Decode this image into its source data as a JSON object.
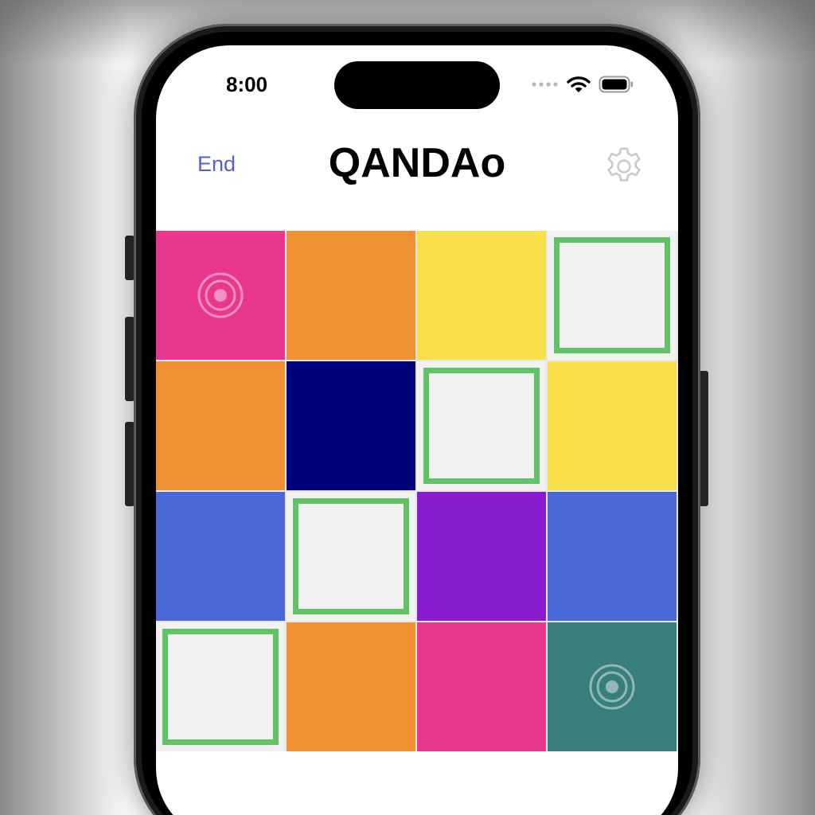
{
  "status_bar": {
    "time": "8:00",
    "signal_icon": "signal-dots-icon",
    "wifi_icon": "wifi-icon",
    "battery_icon": "battery-icon"
  },
  "nav": {
    "end_label": "End",
    "title": "QANDAo",
    "settings_icon": "gear-icon",
    "end_color": "#5a5bd6"
  },
  "board": {
    "empty_border_color": "#62c266",
    "tiles": [
      {
        "color": "#e9378e",
        "icon": "target-icon"
      },
      {
        "color": "#f09234",
        "icon": null
      },
      {
        "color": "#f9df4b",
        "icon": null
      },
      {
        "color": "empty",
        "icon": null
      },
      {
        "color": "#f09234",
        "icon": null
      },
      {
        "color": "#00007b",
        "icon": null
      },
      {
        "color": "empty",
        "icon": null
      },
      {
        "color": "#f9df4b",
        "icon": null
      },
      {
        "color": "#4a68d8",
        "icon": null
      },
      {
        "color": "empty",
        "icon": null
      },
      {
        "color": "#871bcd",
        "icon": null
      },
      {
        "color": "#4a68d8",
        "icon": null
      },
      {
        "color": "empty",
        "icon": null
      },
      {
        "color": "#f09234",
        "icon": null
      },
      {
        "color": "#e9378e",
        "icon": null
      },
      {
        "color": "#387f7c",
        "icon": "target-icon"
      }
    ]
  }
}
